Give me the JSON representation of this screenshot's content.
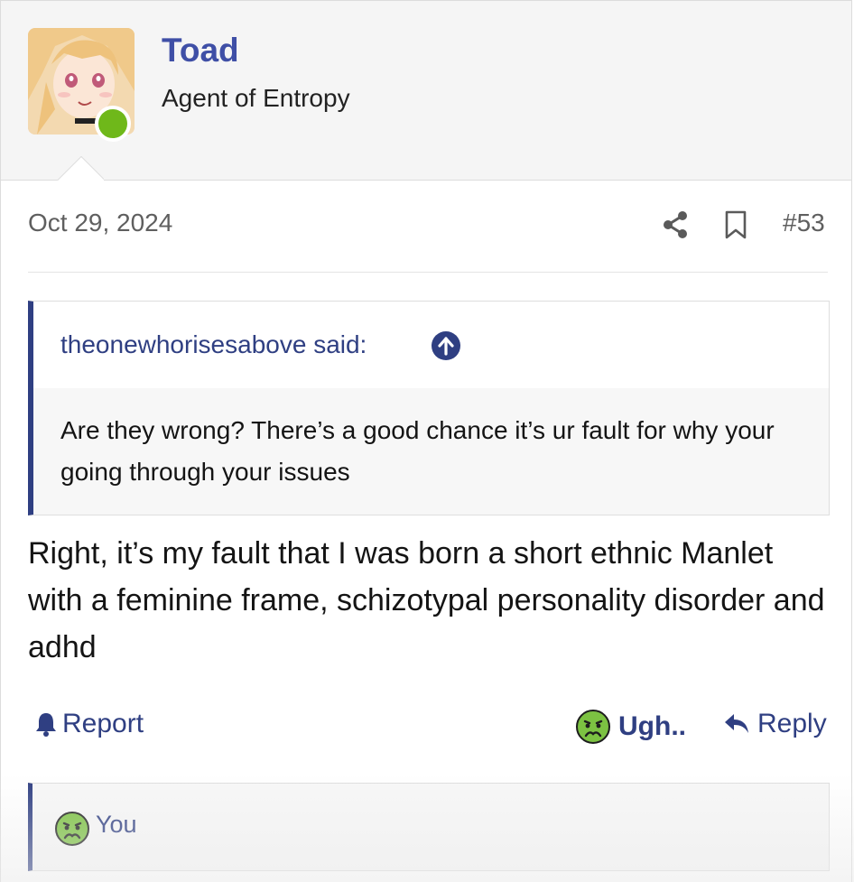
{
  "user": {
    "name": "Toad",
    "title": "Agent of Entropy",
    "online_color": "#6fb81a"
  },
  "post": {
    "date": "Oct 29, 2024",
    "number": "#53",
    "icons": [
      "share-icon",
      "bookmark-icon"
    ]
  },
  "quote": {
    "author_label": "theonewhorisesabove said:",
    "text": "Are they wrong? There’s a good chance it’s ur fault for why your going through your issues"
  },
  "message": {
    "text": "Right, it’s my fault that I was born a short ethnic Manlet with a feminine frame, schizotypal personality disorder and adhd"
  },
  "actions": {
    "report_label": "Report",
    "reaction_label": "Ugh..",
    "reply_label": "Reply"
  },
  "reactions": {
    "reacted_by": "You"
  },
  "colors": {
    "accent": "#2f3f82",
    "username": "#3f4fa6",
    "reaction_face": "#7cc242"
  }
}
